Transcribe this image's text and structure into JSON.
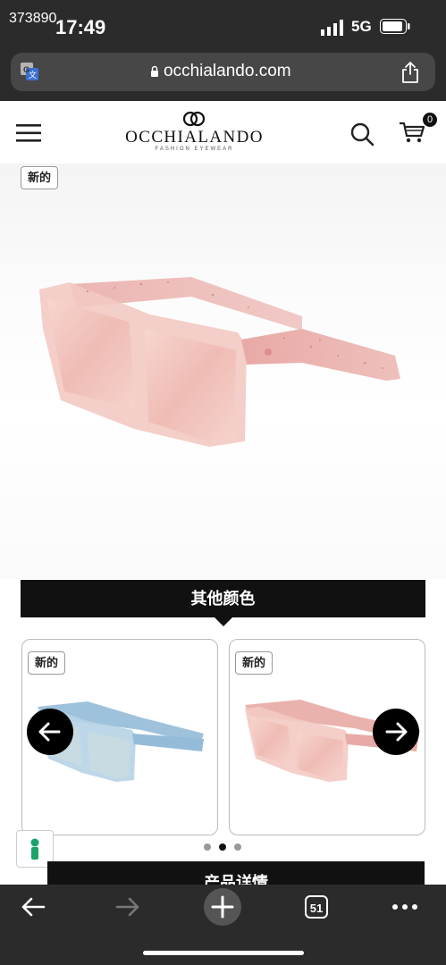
{
  "status_bar": {
    "overlay_text": "373890",
    "time": "17:49",
    "network": "5G",
    "signal_icon": "signal-bars-icon",
    "battery_icon": "battery-icon"
  },
  "browser": {
    "url": "occhialando.com",
    "translate_icon": "translate-icon",
    "lock_icon": "lock-icon",
    "share_icon": "share-icon"
  },
  "header": {
    "brand_name": "OCCHIALANDO",
    "brand_tagline": "FASHION EYEWEAR",
    "menu_icon": "menu-icon",
    "search_icon": "search-icon",
    "cart_icon": "cart-icon",
    "cart_count": "0"
  },
  "hero": {
    "badge": "新的",
    "image": "pink-sunglasses-image"
  },
  "other_colors": {
    "title": "其他颜色",
    "cards": [
      {
        "badge": "新的",
        "image": "blue-sunglasses-image"
      },
      {
        "badge": "新的",
        "image": "pink-sunglasses-image"
      }
    ],
    "prev_icon": "arrow-left-icon",
    "next_icon": "arrow-right-icon",
    "active_dot": 2,
    "dot_count": 3
  },
  "product_details": {
    "title": "产品详情"
  },
  "toolbar": {
    "back_icon": "back-arrow-icon",
    "forward_icon": "forward-arrow-icon",
    "new_tab_icon": "plus-icon",
    "tab_count": "51",
    "more_icon": "more-icon"
  },
  "colors": {
    "chrome_bg": "#2b2b2b",
    "url_bar_bg": "#474747",
    "accent_black": "#111111",
    "frame_pink": "#f2c2bb",
    "frame_blue": "#a9c9df",
    "chat_green": "#1aa36a"
  }
}
